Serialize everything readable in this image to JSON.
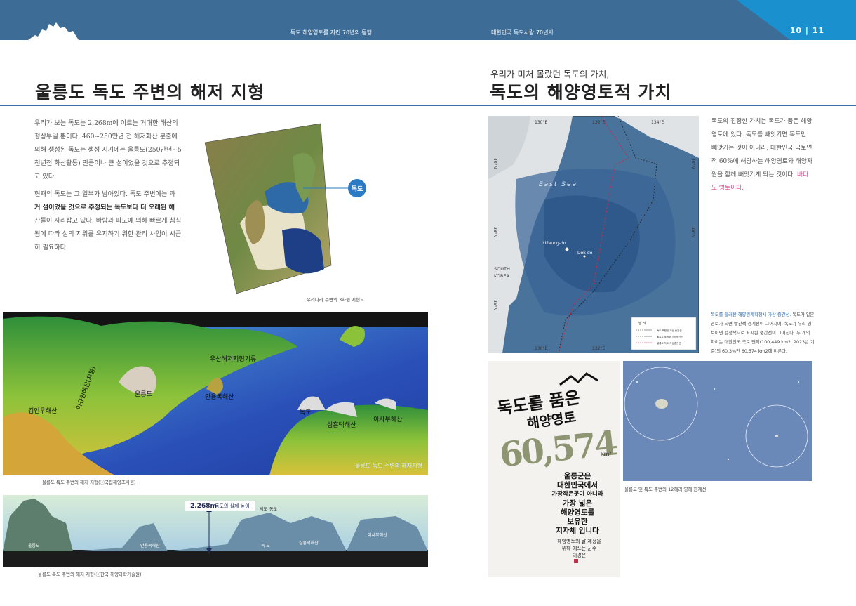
{
  "header": {
    "left_running_title": "독도 해양영토를 지킨 70년의 동행",
    "right_running_title": "대한민국 독도사랑 70년사",
    "page_numbers": "10  |  11"
  },
  "left": {
    "title": "울릉도 독도 주변의 해저 지형",
    "para1": "우리가 보는 독도는 2,268m에 이르는 거대한 해산의 정상부일 뿐이다. 460~250만년 전 해저화산 분출에 의해 생성된 독도는 생성 시기에는 울릉도(250만년~5천년전 화산활동) 만큼이나 큰 섬이었을 것으로 추정되고 있다.",
    "para2_a": "현재의 독도는 그 일부가 남아있다. 독도 주변에는 과",
    "para2_b": "거 섬이었을 것으로 추정되는 독도보다 더 오래된 해",
    "para2_c": "산들이 자리잡고 있다. 바람과 파도에 의해 빠르게 침식됨에 따라 섬의 지위를 유지하기 위한 관리 사업이 시급히 필요하다.",
    "map3d_badge": "독도",
    "map3d_caption": "우리나라 주변의 3차원 지형도",
    "seafloor_labels": [
      "우산해저지형기류",
      "이규원해산(지붕)",
      "울릉도",
      "안용복해산",
      "김인우해산",
      "독도",
      "심흥택해산",
      "이사부해산"
    ],
    "seafloor_watermark": "울릉도 독도 주변의 해저지형",
    "seafloor_caption": "울릉도 독도 주변의 해저 지형(ⓒ국립해양조사원)",
    "profile_height_value": "2.268m",
    "profile_height_label": "독도의 실제 높이",
    "profile_top_labels": [
      "서도",
      "동도"
    ],
    "profile_labels": [
      "울릉도",
      "안용복해산",
      "독 도",
      "심흥택해산",
      "이사부해산"
    ],
    "profile_caption": "울릉도 독도 주변의 해저 지형(ⓒ한국 해양과학기술원)"
  },
  "right": {
    "subtitle": "우리가 미처 몰랐던 독도의 가치,",
    "title": "독도의 해양영토적 가치",
    "para_main": "독도의 진정한 가치는 독도가 품은 해양영토에 있다. 독도를 빼앗기면 독도만 빼앗기는 것이 아니라, 대한민국 국토면적 60%에 해당하는 해양영토와 해양자원을 함께 빼앗기게 되는 것이다.",
    "para_highlight": "바다도 영토이다.",
    "map": {
      "lon_labels": [
        "130°E",
        "132°E",
        "134°E"
      ],
      "lat_labels": [
        "40°N",
        "38°N",
        "36°N"
      ],
      "sea_label": "East Sea",
      "place_labels": [
        "Ulleung-do",
        "Dok-do"
      ],
      "land_label_1": "SOUTH",
      "land_label_2": "KOREA",
      "legend_title": "범 례",
      "legend_items": [
        "독도 포함된 가상 중간선",
        "울릉도 포함된 가상중간선",
        "울릉도 독도 가상중간선"
      ]
    },
    "map_caption_highlight": "독도를 둘러싼 해양경계획정시 가상 중간선.",
    "map_caption": "독도가 일본영토가 되면 빨간색 경계선이 그어지며, 독도가 우리 영토이면 검정색으로 표시된 중간선이 그어진다. 두 개의 차이는 대한민국 국토 면적(100,449 km2, 2023년 기준)의 60.3%인 60,574 km2에 이른다.",
    "calligraphy": {
      "line1": "독도를 품은",
      "line2": "해양영토",
      "number": "60,574",
      "unit": "km²",
      "body_lines": [
        "울릉군은",
        "대한민국에서",
        "가장작은곳이 아니라",
        "가장 넓은",
        "해양영토를",
        "보유한",
        "지자체 입니다"
      ],
      "sign_lines": [
        "해양영토의 날 제정을",
        "위해 애쓰는 군수",
        "이경은"
      ]
    },
    "aerial_caption": "울릉도 및 독도 주변의 12해리 영해 한계선"
  },
  "colors": {
    "header_bg": "#3d6d96",
    "header_accent": "#1b90cf",
    "rule": "#3a6fa8",
    "highlight_pink": "#e0458b",
    "caption_blue": "#2e6db4"
  }
}
